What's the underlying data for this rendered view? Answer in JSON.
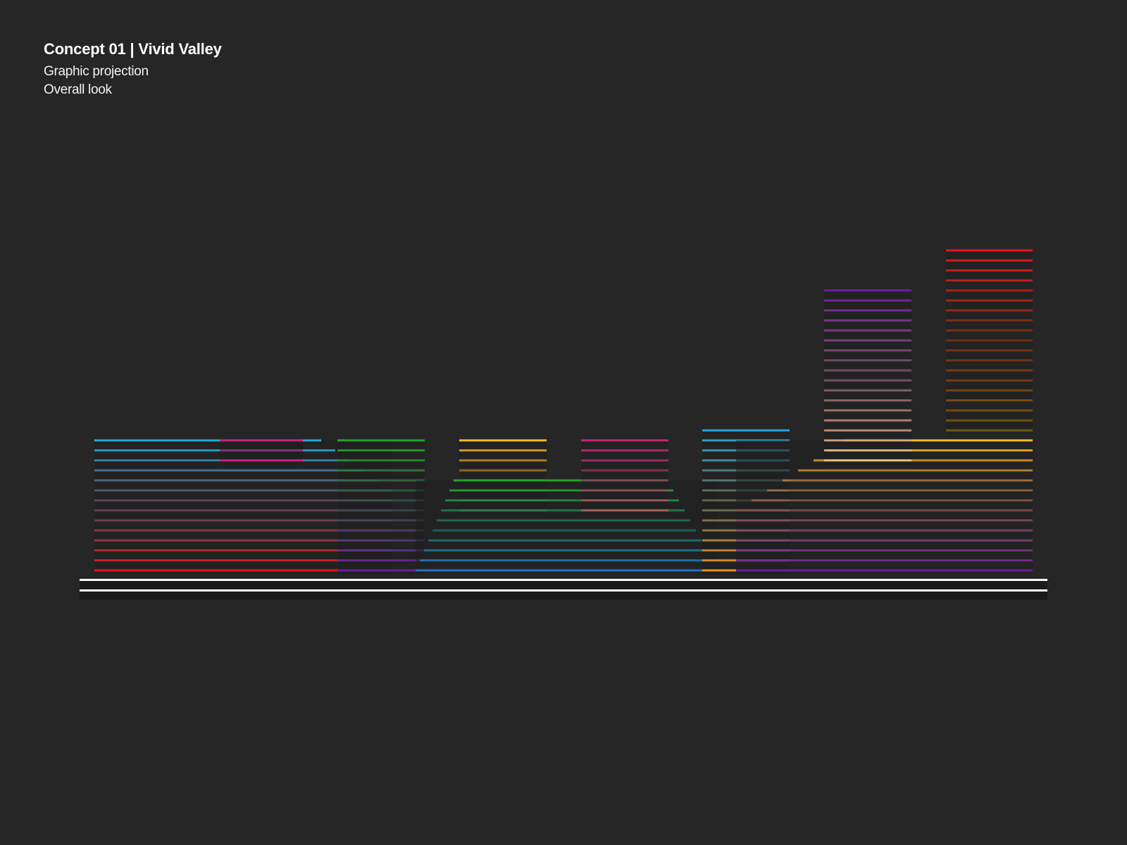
{
  "header": {
    "title": "Concept 01 | Vivid Valley",
    "subtitle_lines": [
      "Graphic projection",
      "Overall look"
    ]
  },
  "colors": {
    "background": "#262626",
    "ground_line": "#ffffff",
    "palette": {
      "cyan": "#1ea9d8",
      "magenta": "#c8207a",
      "red": "#e5161a",
      "green": "#1fa526",
      "dark_green": "#168c4a",
      "yellow": "#f4b81c",
      "orange": "#f08e1e",
      "purple": "#6b1fa0",
      "violet": "#4a1a8c",
      "blue": "#1e73c8",
      "teal": "#169aa6",
      "olive": "#6e5a10"
    }
  },
  "buildings": [
    {
      "name": "block-west-low",
      "floors": 14,
      "top_color": "#1ea9d8",
      "bottom_color": "#e5161a"
    },
    {
      "name": "block-west-cap",
      "floors": 3,
      "top_color": "#c8207a",
      "bottom_color": "#c8207a"
    },
    {
      "name": "tower-green",
      "floors": 14,
      "top_color": "#1fa526",
      "bottom_color": "#6b1fa0"
    },
    {
      "name": "tower-yellow",
      "floors": 8,
      "top_color": "#f4b81c",
      "bottom_color": "#a06060"
    },
    {
      "name": "terrace-center",
      "floors": 10,
      "top_color": "#1fa526",
      "bottom_color": "#1e73c8"
    },
    {
      "name": "tower-magenta",
      "floors": 8,
      "top_color": "#c8207a",
      "bottom_color": "#a06060"
    },
    {
      "name": "tower-cyan",
      "floors": 15,
      "top_color": "#1ea9d8",
      "bottom_color": "#f08e1e"
    },
    {
      "name": "block-east-low",
      "floors": 14,
      "top_color": "#f4b81c",
      "bottom_color": "#6b1fa0"
    },
    {
      "name": "tower-violet",
      "floors": 18,
      "top_color": "#6b1fa0",
      "bottom_color": "#e8c080"
    },
    {
      "name": "tower-red",
      "floors": 19,
      "top_color": "#e5161a",
      "bottom_color": "#6e5a10"
    }
  ]
}
